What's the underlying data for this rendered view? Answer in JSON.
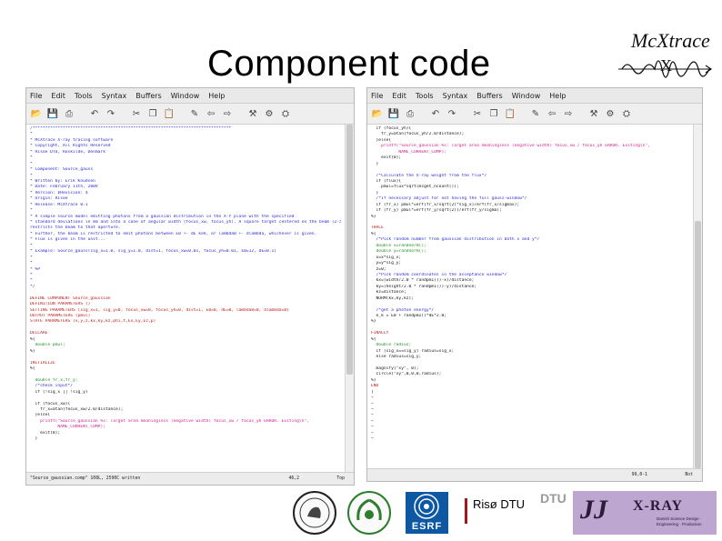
{
  "slide": {
    "title": "Component code"
  },
  "logo": {
    "name": "Mc Xtrace",
    "wordmark": "McXtrace",
    "glyph": "X"
  },
  "menu": [
    "File",
    "Edit",
    "Tools",
    "Syntax",
    "Buffers",
    "Window",
    "Help"
  ],
  "toolbar_icons": [
    "open-file-icon",
    "save-icon",
    "print-icon",
    "undo-icon",
    "redo-icon",
    "cut-icon",
    "copy-icon",
    "paste-icon",
    "edit-icon",
    "back-icon",
    "forward-icon",
    "build-icon",
    "make-icon",
    "tool-icon"
  ],
  "colors": {
    "comment": "#2a2ad6",
    "keyword": "#c01818",
    "string": "#d4178f",
    "type": "#1a8f1a",
    "text": "#111111"
  },
  "left_editor": {
    "lines": [
      {
        "t": "/*******************************************************************************",
        "c": "comment"
      },
      {
        "t": "*",
        "c": "comment"
      },
      {
        "t": "* McXtrace X-ray tracing software",
        "c": "comment"
      },
      {
        "t": "* Copyright, All Rights Reserved",
        "c": "comment"
      },
      {
        "t": "* Risoe DTU, Roskilde, Denmark",
        "c": "comment"
      },
      {
        "t": "*",
        "c": "comment"
      },
      {
        "t": "*",
        "c": "comment"
      },
      {
        "t": "* Component: Source_gauss",
        "c": "comment"
      },
      {
        "t": "*",
        "c": "comment"
      },
      {
        "t": "* Written by: Erik Knudsen",
        "c": "comment"
      },
      {
        "t": "* Date: February 11th, 2009",
        "c": "comment"
      },
      {
        "t": "* Version: $Revision: $",
        "c": "comment"
      },
      {
        "t": "* Origin: Risoe",
        "c": "comment"
      },
      {
        "t": "* Release: McXtrace 0.1",
        "c": "comment"
      },
      {
        "t": "*",
        "c": "comment"
      },
      {
        "t": "* A simple source model emitting photons from a gaussian distribution in the X-Y plane with the specified",
        "c": "comment"
      },
      {
        "t": "* standard deviations in mm and into a cone of angular width (focus_xw, focus_yh). A square target centered on the beam (Z-axis)",
        "c": "comment"
      },
      {
        "t": "restricts the beam to that aperture.",
        "c": "comment"
      },
      {
        "t": "* Further, the beam is restricted to emit photons between E0 +- dE keV, or lambda0 +- dlambda, whichever is given.",
        "c": "comment"
      },
      {
        "t": "* Flux is given in the unit...",
        "c": "comment"
      },
      {
        "t": "*",
        "c": "comment"
      },
      {
        "t": "* Example: Source_gauss(sig_x=1.0, sig_y=1.0, dist=1, focus_xw=0.01, focus_yh=0.01, E0=12, dE=0.1)",
        "c": "comment"
      },
      {
        "t": "*",
        "c": "comment"
      },
      {
        "t": "*",
        "c": "comment"
      },
      {
        "t": "* %P",
        "c": "comment"
      },
      {
        "t": "*",
        "c": "comment"
      },
      {
        "t": "*",
        "c": "comment"
      },
      {
        "t": "*/",
        "c": "comment"
      },
      {
        "t": "",
        "c": "text"
      },
      {
        "t": "DEFINE COMPONENT Source_gaussian",
        "c": "keyword"
      },
      {
        "t": "DEFINITION PARAMETERS ()",
        "c": "keyword"
      },
      {
        "t": "SETTING PARAMETERS (sig_x=1, sig_y=0, focus_xw=0, focus_yh=0, dist=1, E0=0, dE=0, lambda0=0, dlambda=0)",
        "c": "keyword"
      },
      {
        "t": "OUTPUT PARAMETERS (pmul)",
        "c": "keyword"
      },
      {
        "t": "STATE PARAMETERS (x,y,z,kx,ky,kz,phi,t,Ex,Ey,Ez,p)",
        "c": "keyword"
      },
      {
        "t": "",
        "c": "text"
      },
      {
        "t": "DECLARE",
        "c": "keyword"
      },
      {
        "t": "%{",
        "c": "text"
      },
      {
        "t": "  double pmul;",
        "c": "type"
      },
      {
        "t": "%}",
        "c": "text"
      },
      {
        "t": "",
        "c": "text"
      },
      {
        "t": "INITIALIZE",
        "c": "keyword"
      },
      {
        "t": "%{",
        "c": "text"
      },
      {
        "t": "",
        "c": "text"
      },
      {
        "t": "  double fr_x,fr_y;",
        "c": "type"
      },
      {
        "t": "  /*check input*/",
        "c": "comment"
      },
      {
        "t": "  if (!sig_x || !sig_y)",
        "c": "text"
      },
      {
        "t": "",
        "c": "text"
      },
      {
        "t": "  if (focus_xw){",
        "c": "text"
      },
      {
        "t": "    fr_x=atan(focus_xw/2.0/distance);",
        "c": "text"
      },
      {
        "t": "  }else{",
        "c": "text"
      },
      {
        "t": "    printf(\"Source_gaussian %s: Target area meaningless (negative width) focus_xw / focus_yh ERROR. Exiting\\n\",",
        "c": "string"
      },
      {
        "t": "           NAME_CURRENT_COMP);",
        "c": "string"
      },
      {
        "t": "    exit(0);",
        "c": "text"
      },
      {
        "t": "  }",
        "c": "text"
      }
    ],
    "status": {
      "file": "\"Source_gaussian.comp\" 108L, 2590C written",
      "position": "46,2",
      "percent": "Top"
    }
  },
  "right_editor": {
    "lines": [
      {
        "t": "  if (focus_yh){",
        "c": "text"
      },
      {
        "t": "    fr_y=atan(focus_yh/2.0/distance);",
        "c": "text"
      },
      {
        "t": "  }else{",
        "c": "text"
      },
      {
        "t": "    printf(\"Source_gaussian %s: Target area meaningless (negative width) focus_xw / focus_yh ERROR. Exiting\\n\",",
        "c": "string"
      },
      {
        "t": "           NAME_CURRENT_COMP);",
        "c": "string"
      },
      {
        "t": "    exit(0);",
        "c": "text"
      },
      {
        "t": "  }",
        "c": "text"
      },
      {
        "t": "",
        "c": "text"
      },
      {
        "t": "  /*Calculate the X-ray weight from the flux*/",
        "c": "comment"
      },
      {
        "t": "  if (flux){",
        "c": "text"
      },
      {
        "t": "    pmul=flux*sqrt(mcget_ncount());",
        "c": "text"
      },
      {
        "t": "  }",
        "c": "text"
      },
      {
        "t": "  /*if necessary adjust for not having the full gauss-window*/",
        "c": "comment"
      },
      {
        "t": "  if (fr_x) pmul*=erf(fr_x/sqrt(2)*sig_x)/erf(fr_x/sigmax);",
        "c": "text"
      },
      {
        "t": "  if (fr_y) pmul*=erf(fr_y/sqrt(2))/erf(fr_y/sigma);",
        "c": "text"
      },
      {
        "t": "%}",
        "c": "text"
      },
      {
        "t": "",
        "c": "text"
      },
      {
        "t": "TRACE",
        "c": "keyword"
      },
      {
        "t": "%{",
        "c": "text"
      },
      {
        "t": "  /*Pick random number from gaussian distribution in both x and y*/",
        "c": "comment"
      },
      {
        "t": "  double x=randnorm();",
        "c": "type"
      },
      {
        "t": "  double y=randnorm();",
        "c": "type"
      },
      {
        "t": "  x=x*sig_x;",
        "c": "text"
      },
      {
        "t": "  y=y*sig_y;",
        "c": "text"
      },
      {
        "t": "  z=0;",
        "c": "text"
      },
      {
        "t": "  /*Pick random coordinates in the acceptance window*/",
        "c": "comment"
      },
      {
        "t": "  kx=(width/2.0 * randpm1())-x)/distance;",
        "c": "text"
      },
      {
        "t": "  ky=(height/2.0 * randpm1())-y)/distance;",
        "c": "text"
      },
      {
        "t": "  kz=distance;",
        "c": "text"
      },
      {
        "t": "  NORM(kx,ky,kz);",
        "c": "text"
      },
      {
        "t": "",
        "c": "text"
      },
      {
        "t": "  /*get a photon energy*/",
        "c": "comment"
      },
      {
        "t": "  e_k = E0 + randpm1()*dE*2.0;",
        "c": "text"
      },
      {
        "t": "%}",
        "c": "text"
      },
      {
        "t": "",
        "c": "text"
      },
      {
        "t": "FINALLY",
        "c": "keyword"
      },
      {
        "t": "%{",
        "c": "text"
      },
      {
        "t": "  double radius;",
        "c": "type"
      },
      {
        "t": "  if (sig_x==sig_y) radius=sig_x;",
        "c": "text"
      },
      {
        "t": "  else radius=sig_y;",
        "c": "text"
      },
      {
        "t": "",
        "c": "text"
      },
      {
        "t": "  magnify(\"xy\", 0);",
        "c": "text"
      },
      {
        "t": "  circle(\"xy\",0,0,0,radius);",
        "c": "text"
      },
      {
        "t": "%}",
        "c": "text"
      },
      {
        "t": "END",
        "c": "keyword"
      },
      {
        "t": "[",
        "c": "text"
      },
      {
        "t": "~",
        "c": "comment"
      },
      {
        "t": "~",
        "c": "comment"
      },
      {
        "t": "~",
        "c": "comment"
      },
      {
        "t": "~",
        "c": "comment"
      },
      {
        "t": "~",
        "c": "comment"
      },
      {
        "t": "~",
        "c": "comment"
      },
      {
        "t": "~",
        "c": "comment"
      },
      {
        "t": "~",
        "c": "comment"
      }
    ],
    "status": {
      "file": "",
      "position": "99,0-1",
      "percent": "Bot"
    }
  },
  "partners": {
    "esrf": "ESRF",
    "riso": "Risø DTU",
    "dtu": "DTU",
    "jjx_mark": "JJ",
    "jjx_name": "X-RAY",
    "jjx_tagline": "Danish Science Design · Engineering · Production"
  }
}
